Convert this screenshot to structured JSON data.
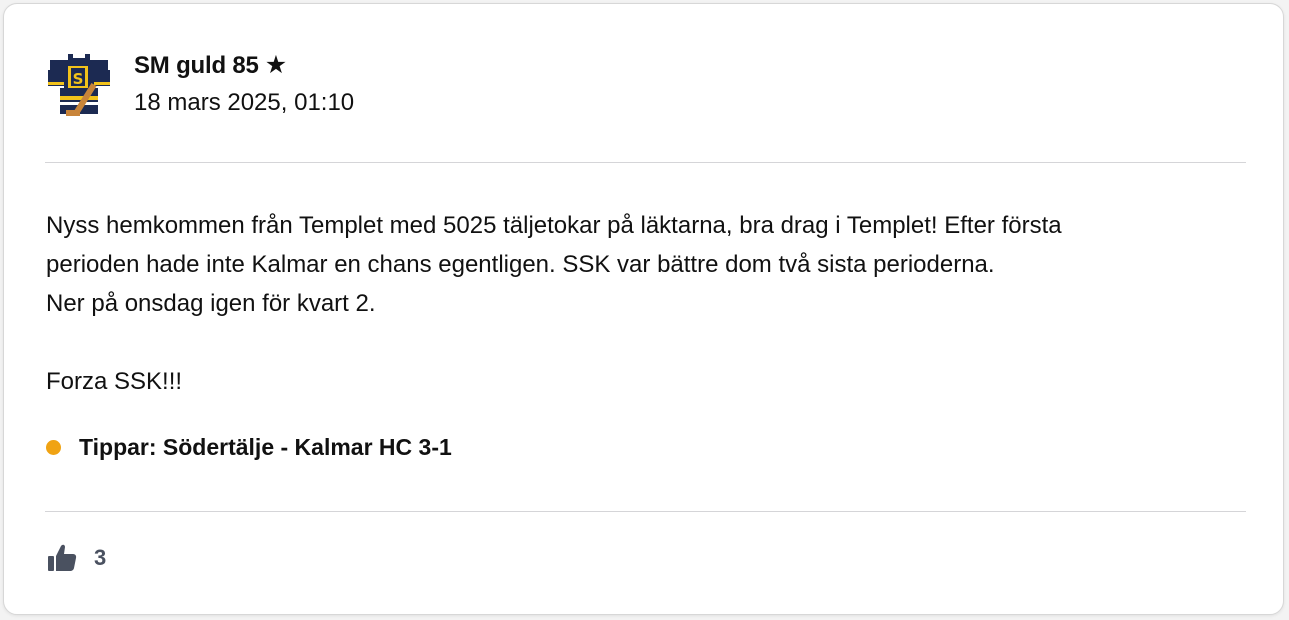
{
  "post": {
    "author": "SM guld 85",
    "author_star": "★",
    "date": "18 mars 2025, 01:10",
    "avatar_icon": "hockey-jersey-icon",
    "body": {
      "line1": "Nyss hemkommen från Templet med 5025 täljetokar på läktarna, bra drag i Templet! Efter första",
      "line2": "perioden hade inte Kalmar en chans egentligen. SSK var bättre dom två sista perioderna.",
      "line3": "Ner på onsdag igen för kvart 2.",
      "line4": "Forza SSK!!!"
    },
    "prediction": "Tippar: Södertälje - Kalmar HC 3-1",
    "prediction_color": "#f0a313",
    "likes": "3",
    "like_icon": "thumbs-up-icon"
  },
  "colors": {
    "jersey_navy": "#1c2a52",
    "jersey_gold": "#f2c21a",
    "stick_brown": "#c8843a",
    "like_icon": "#4a5160"
  }
}
